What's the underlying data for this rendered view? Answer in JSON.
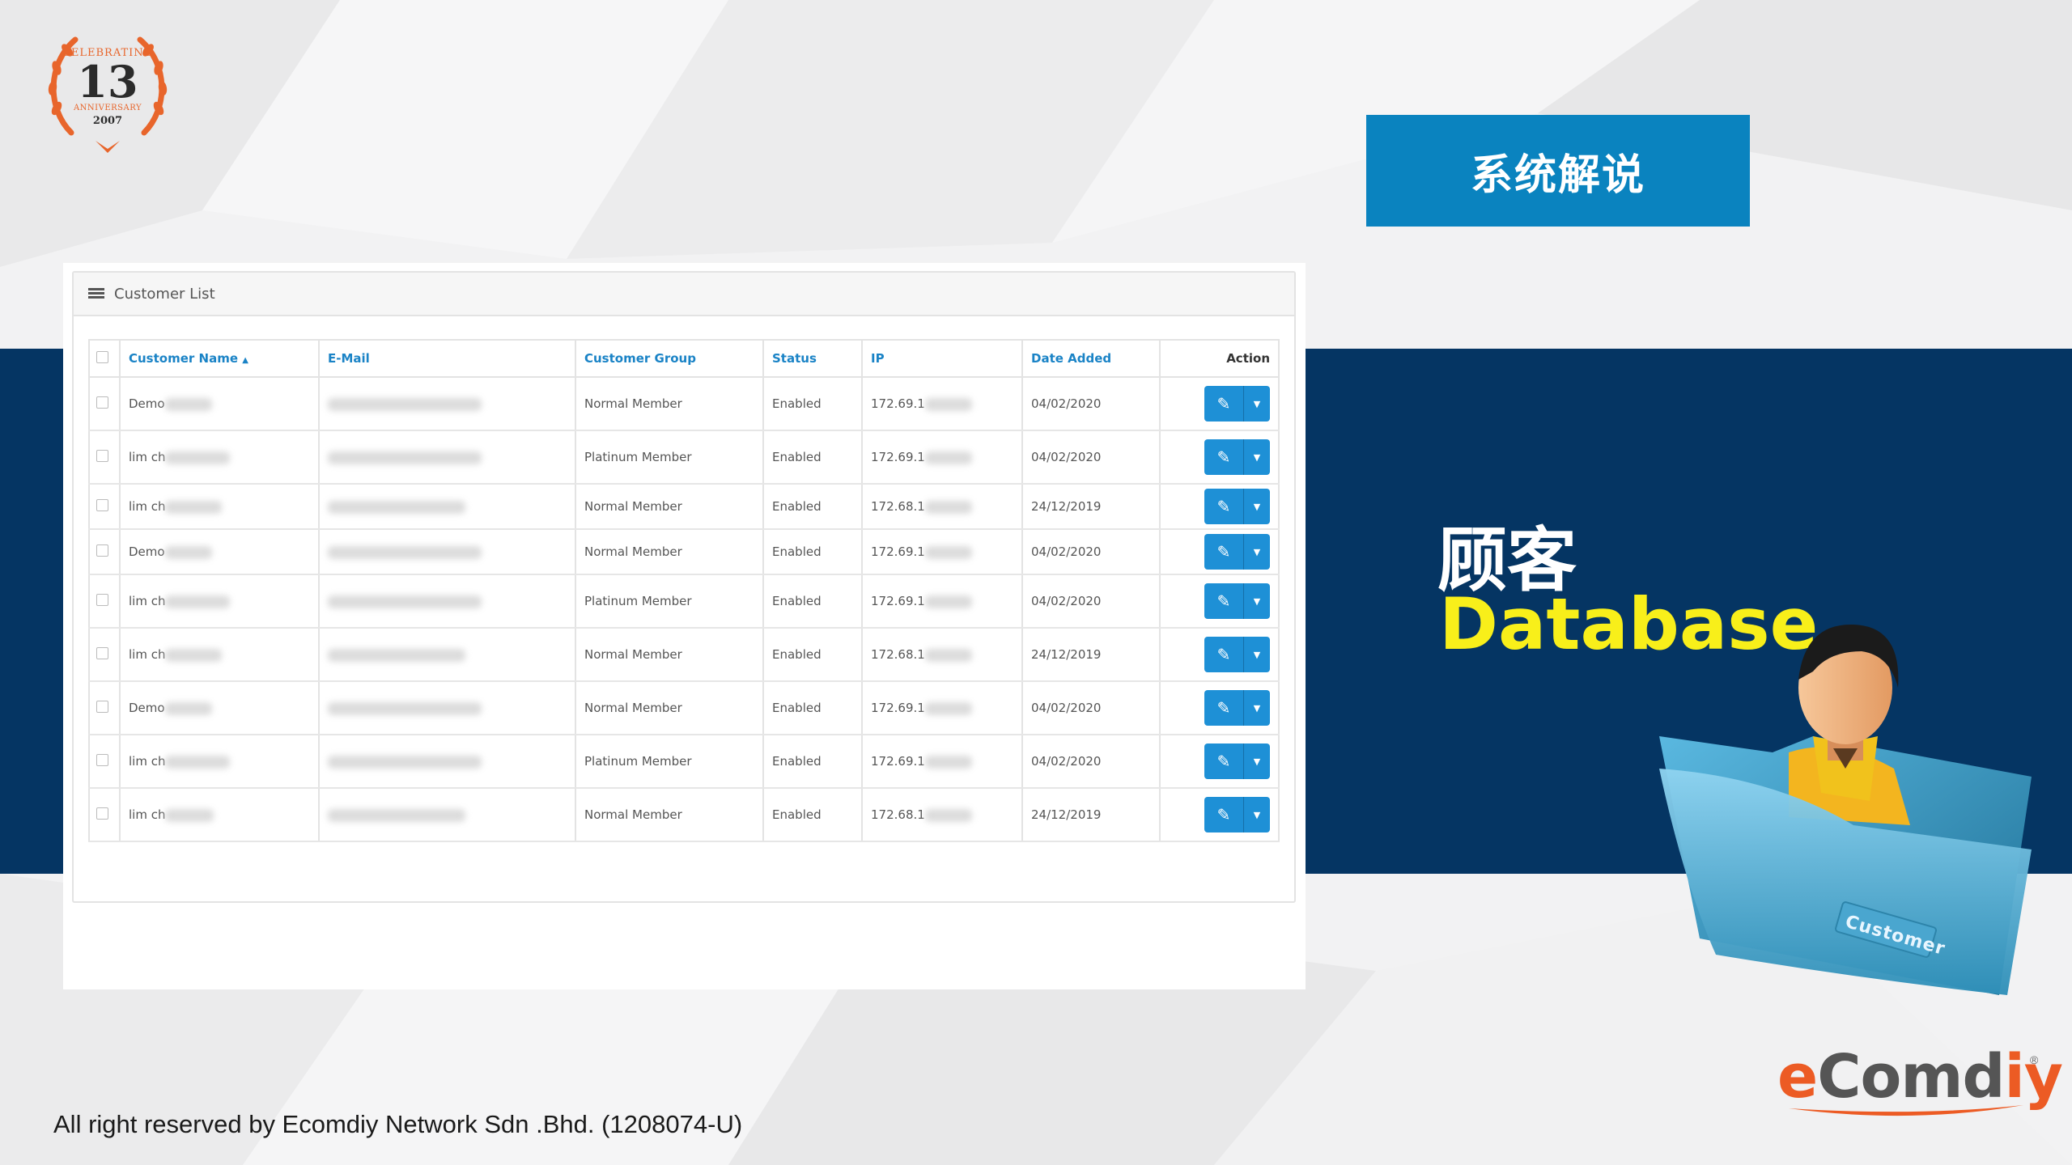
{
  "badge": {
    "top_text": "CELEBRATING",
    "number": "13",
    "anniversary": "ANNIVERSARY",
    "year": "2007"
  },
  "title_box": "系统解说",
  "panel": {
    "card_title": "Customer List",
    "columns": {
      "name": "Customer Name",
      "email": "E-Mail",
      "group": "Customer Group",
      "status": "Status",
      "ip": "IP",
      "date": "Date Added",
      "action": "Action"
    },
    "rows": [
      {
        "name": "Demo",
        "group": "Normal Member",
        "status": "Enabled",
        "ip": "172.69.1",
        "date": "04/02/2020"
      },
      {
        "name": "lim ch",
        "group": "Platinum Member",
        "status": "Enabled",
        "ip": "172.69.1",
        "date": "04/02/2020"
      },
      {
        "name": "lim ch",
        "group": "Normal Member",
        "status": "Enabled",
        "ip": "172.68.1",
        "date": "24/12/2019"
      },
      {
        "name": "Demo",
        "group": "Normal Member",
        "status": "Enabled",
        "ip": "172.69.1",
        "date": "04/02/2020"
      },
      {
        "name": "lim ch",
        "group": "Platinum Member",
        "status": "Enabled",
        "ip": "172.69.1",
        "date": "04/02/2020"
      },
      {
        "name": "lim ch",
        "group": "Normal Member",
        "status": "Enabled",
        "ip": "172.68.1",
        "date": "24/12/2019"
      },
      {
        "name": "Demo",
        "group": "Normal Member",
        "status": "Enabled",
        "ip": "172.69.1",
        "date": "04/02/2020"
      },
      {
        "name": "lim ch",
        "group": "Platinum Member",
        "status": "Enabled",
        "ip": "172.69.1",
        "date": "04/02/2020"
      },
      {
        "name": "lim ch",
        "group": "Normal Member",
        "status": "Enabled",
        "ip": "172.68.1",
        "date": "24/12/2019"
      }
    ]
  },
  "heading_cn": "顾客",
  "heading_en": "Database",
  "illustration_label": "Customer",
  "logo": {
    "e": "e",
    "mid": "Comd",
    "end": "iy",
    "reg": "®"
  },
  "footer": "All right reserved by Ecomdiy Network Sdn .Bhd. (1208074-U)",
  "colors": {
    "band": "#053563",
    "title_box": "#0a83bf",
    "accent_yellow": "#f8ef1a",
    "link_blue": "#1a83c6",
    "button_blue": "#1e90d6",
    "brand_orange": "#ec5b24"
  }
}
